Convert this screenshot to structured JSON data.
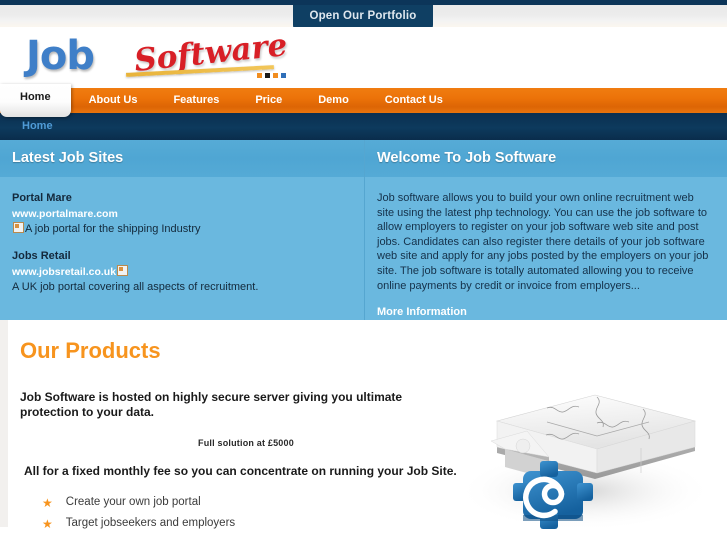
{
  "topbar": {
    "portfolio_label": "Open Our Portfolio"
  },
  "logo": {
    "word_job": "Job",
    "word_software": "Software",
    "dot_colors": [
      "#f18d1f",
      "#1a1a1a",
      "#f18d1f",
      "#2f6fb8"
    ]
  },
  "nav": {
    "items": [
      {
        "label": "Home",
        "active": true
      },
      {
        "label": "About Us",
        "active": false
      },
      {
        "label": "Features",
        "active": false
      },
      {
        "label": "Price",
        "active": false
      },
      {
        "label": "Demo",
        "active": false
      },
      {
        "label": "Contact Us",
        "active": false
      }
    ]
  },
  "breadcrumb": {
    "label": "Home"
  },
  "panels": {
    "left": {
      "title": "Latest Job Sites",
      "sites": [
        {
          "name": "Portal Mare",
          "url": "www.portalmare.com",
          "description": "A job portal for the shipping Industry"
        },
        {
          "name": "Jobs Retail",
          "url": "www.jobsretail.co.uk",
          "description": "A UK job portal covering all aspects of recruitment."
        }
      ]
    },
    "right": {
      "title": "Welcome To Job Software",
      "body": "Job software allows you to build your own online recruitment web site using the latest php technology. You can use the job software to allow employers to register on your job software web site and post jobs. Candidates can also register there details of your job software web site and apply for any jobs posted by the employers on your job site. The job software is totally automated allowing you to receive online payments by credit or invoice from employers...",
      "more_link": "More Information"
    }
  },
  "products": {
    "title": "Our Products",
    "lead": "Job Software is hosted on highly secure server giving you ultimate protection to your data.",
    "price_note": "Full solution at £5000",
    "fixed_fee": "All for a fixed monthly fee so you can concentrate on running your Job Site.",
    "bullets": [
      "Create your own job portal",
      "Target jobseekers and employers"
    ]
  },
  "colors": {
    "accent_orange": "#f7941e",
    "nav_orange": "#ec7309",
    "navy": "#0c3559",
    "panel_blue": "#6ab8df",
    "panel_head_blue": "#52a8d4",
    "logo_blue": "#3f7fc8",
    "logo_red": "#d81f26"
  }
}
